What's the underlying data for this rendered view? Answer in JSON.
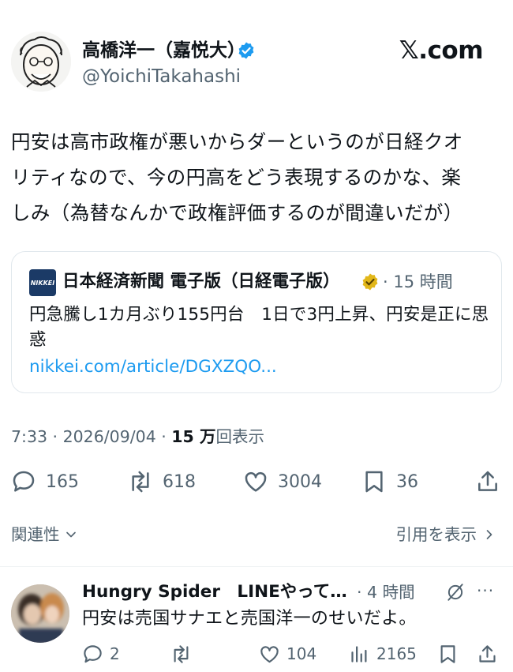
{
  "author": {
    "name": "高橋洋一（嘉悦大）",
    "handle": "@YoichiTakahashi"
  },
  "brand": "𝕏.com",
  "tweet": {
    "text_lines": [
      "円安は高市政権が悪いからダーというのが日経クオ",
      "リティなので、今の円高をどう表現するのかな、楽",
      "しみ（為替なんかで政権評価するのが間違いだが）"
    ]
  },
  "card": {
    "logo_text": "NIKKEI",
    "source": "日本経済新聞 電子版（日経電子版）",
    "time": "· 15 時間",
    "title": "円急騰し1カ月ぶり155円台　1日で3円上昇、円安是正に思惑",
    "link": "nikkei.com/article/DGXZQO..."
  },
  "meta": {
    "time_date": "7:33 · 2026/09/04 · ",
    "views_count": "15 万",
    "views_label": "回表示"
  },
  "actions": {
    "replies": "165",
    "reposts": "618",
    "likes": "3004",
    "bookmarks": "36"
  },
  "relevance_label": "関連性",
  "quotes_label": "引用を表示",
  "reply": {
    "name": "Hungry Spider　LINEやって…",
    "time": "· 4 時間",
    "more": "···",
    "text": "円安は売国サナエと売国洋一のせいだよ。",
    "replies": "2",
    "reposts": "",
    "likes": "104",
    "views": "2165"
  },
  "colors": {
    "primary_text": "#0f1419",
    "secondary_text": "#536471",
    "link": "#1d9bf0",
    "verified_blue": "#1d9bf0",
    "verified_gold": "#e2b719",
    "border": "#e1e8ed"
  }
}
